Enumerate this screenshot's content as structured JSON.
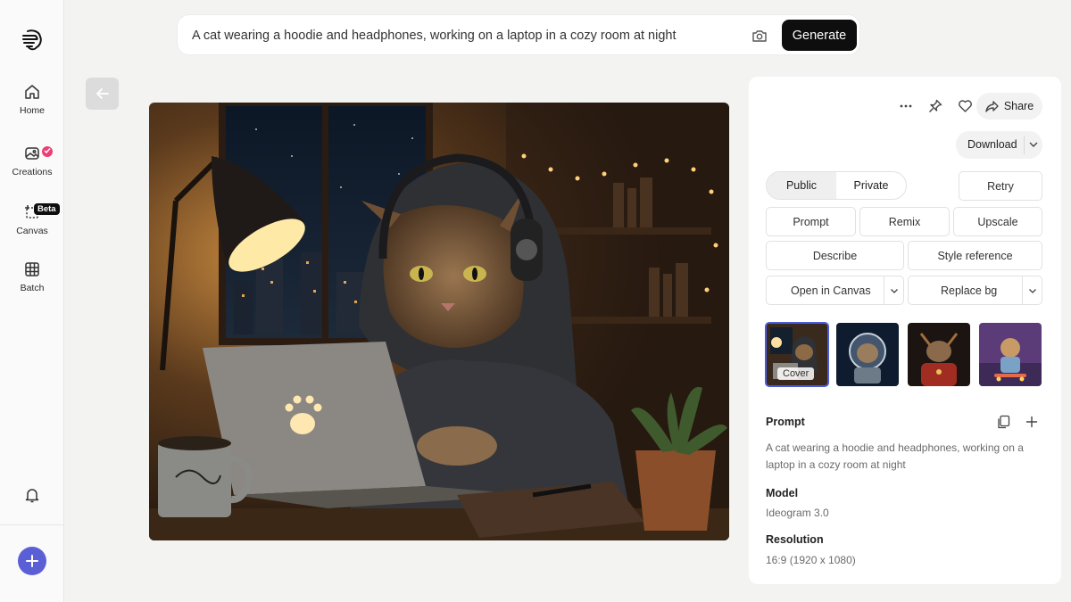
{
  "sidebar": {
    "items": [
      {
        "label": "Home",
        "icon": "home-icon"
      },
      {
        "label": "Creations",
        "icon": "image-icon"
      },
      {
        "label": "Canvas",
        "icon": "canvas-icon",
        "badge": "Beta"
      },
      {
        "label": "Batch",
        "icon": "grid-icon"
      }
    ]
  },
  "search": {
    "prompt": "A cat wearing a hoodie and headphones, working on a laptop in a cozy room at night",
    "generate_label": "Generate"
  },
  "panel": {
    "share_label": "Share",
    "download_label": "Download",
    "visibility": {
      "public": "Public",
      "private": "Private",
      "selected": "Public"
    },
    "actions": {
      "retry": "Retry",
      "prompt": "Prompt",
      "remix": "Remix",
      "upscale": "Upscale",
      "describe": "Describe",
      "style_reference": "Style reference",
      "open_in_canvas": "Open in Canvas",
      "replace_bg": "Replace bg"
    },
    "cover_label": "Cover",
    "prompt_heading": "Prompt",
    "prompt_text": "A cat wearing a hoodie and headphones, working on a laptop in a cozy room at night",
    "model_heading": "Model",
    "model_value": "Ideogram 3.0",
    "resolution_heading": "Resolution",
    "resolution_value": "16:9 (1920 x 1080)"
  },
  "colors": {
    "accent": "#5b5fd6",
    "badge": "#ec3f73",
    "generate": "#0e0e0e"
  }
}
